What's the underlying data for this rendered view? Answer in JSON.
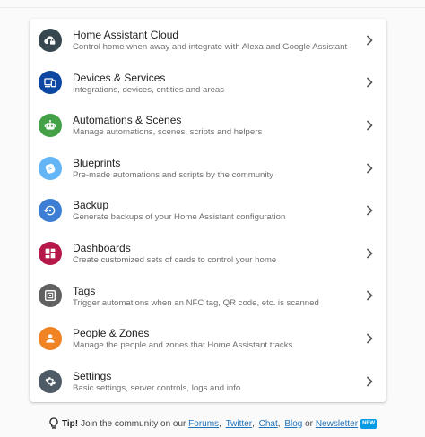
{
  "menu": {
    "items": [
      {
        "title": "Home Assistant Cloud",
        "description": "Control home when away and integrate with Alexa and Google Assistant",
        "icon": "cloud-lock-icon",
        "color": "#37474f"
      },
      {
        "title": "Devices & Services",
        "description": "Integrations, devices, entities and areas",
        "icon": "devices-icon",
        "color": "#0d47a1"
      },
      {
        "title": "Automations & Scenes",
        "description": "Manage automations, scenes, scripts and helpers",
        "icon": "robot-icon",
        "color": "#43a047"
      },
      {
        "title": "Blueprints",
        "description": "Pre-made automations and scripts by the community",
        "icon": "paper-roll-icon",
        "color": "#64b5f6"
      },
      {
        "title": "Backup",
        "description": "Generate backups of your Home Assistant configuration",
        "icon": "backup-restore-icon",
        "color": "#3b7ed3"
      },
      {
        "title": "Dashboards",
        "description": "Create customized sets of cards to control your home",
        "icon": "dashboard-icon",
        "color": "#b5194a"
      },
      {
        "title": "Tags",
        "description": "Trigger automations when an NFC tag, QR code, etc. is scanned",
        "icon": "nfc-tag-icon",
        "color": "#616161"
      },
      {
        "title": "People & Zones",
        "description": "Manage the people and zones that Home Assistant tracks",
        "icon": "account-icon",
        "color": "#f08424"
      },
      {
        "title": "Settings",
        "description": "Basic settings, server controls, logs and info",
        "icon": "gear-icon",
        "color": "#4e5b66"
      }
    ]
  },
  "tip": {
    "label": "Tip!",
    "text": "Join the community on our",
    "links": [
      "Forums",
      "Twitter",
      "Chat",
      "Blog"
    ],
    "or": "or",
    "newsletter": "Newsletter",
    "badge": "NEW"
  }
}
